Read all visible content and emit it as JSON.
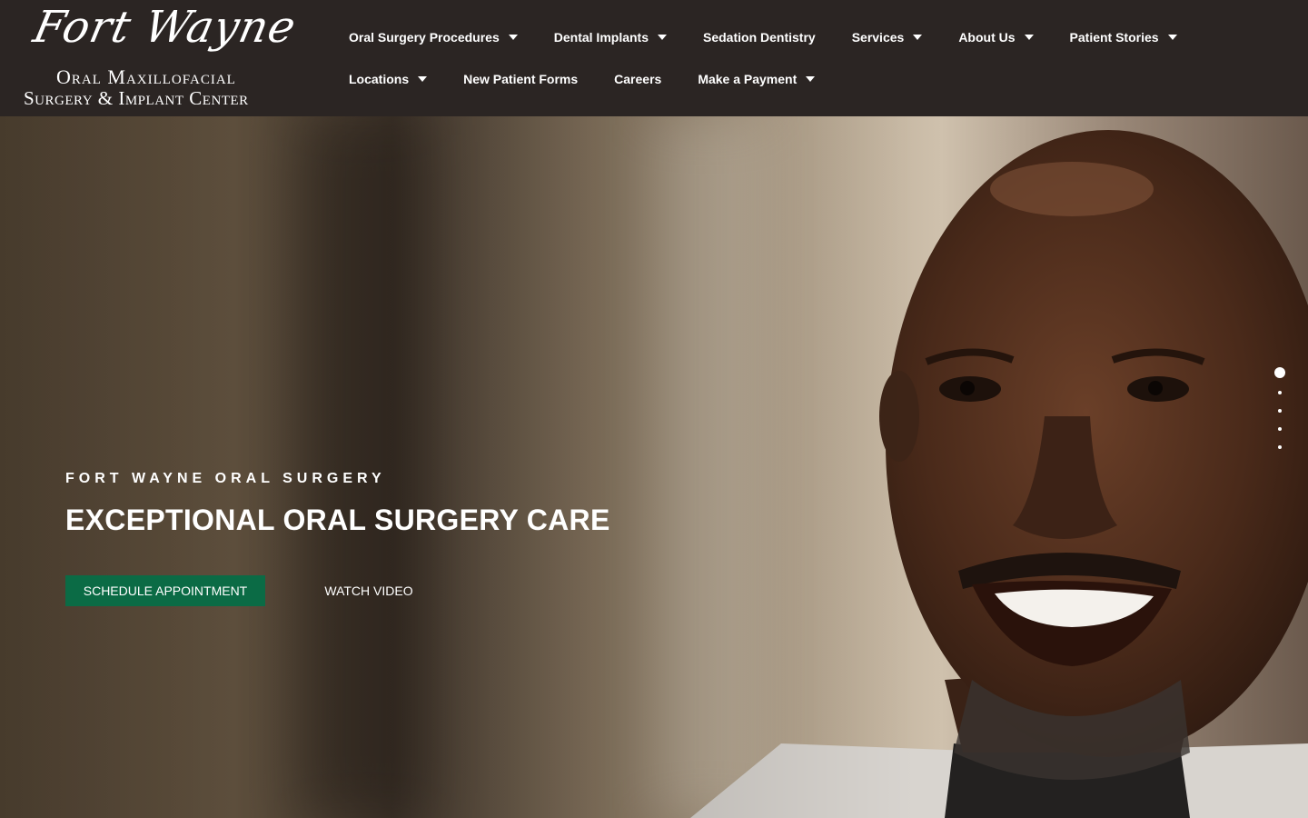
{
  "brand": {
    "script": "Fort Wayne",
    "line1": "Oral Maxillofacial",
    "line2": "Surgery & Implant Center"
  },
  "nav": {
    "row1": [
      {
        "label": "Oral Surgery Procedures",
        "dropdown": true
      },
      {
        "label": "Dental Implants",
        "dropdown": true
      },
      {
        "label": "Sedation Dentistry",
        "dropdown": false
      },
      {
        "label": "Services",
        "dropdown": true
      },
      {
        "label": "About Us",
        "dropdown": true
      },
      {
        "label": "Patient Stories",
        "dropdown": true
      }
    ],
    "row2": [
      {
        "label": "Locations",
        "dropdown": true
      },
      {
        "label": "New Patient Forms",
        "dropdown": false
      },
      {
        "label": "Careers",
        "dropdown": false
      },
      {
        "label": "Make a Payment",
        "dropdown": true
      }
    ]
  },
  "hero": {
    "kicker": "FORT WAYNE ORAL SURGERY",
    "title": "EXCEPTIONAL ORAL SURGERY CARE",
    "primary_button": "SCHEDULE APPOINTMENT",
    "secondary_button": "WATCH VIDEO",
    "image_icon": "smiling-patient-photo",
    "slider": {
      "count": 5,
      "active": 1
    }
  },
  "colors": {
    "header_bg": "#2b2523",
    "accent_green": "#0b6b45",
    "text": "#ffffff"
  }
}
